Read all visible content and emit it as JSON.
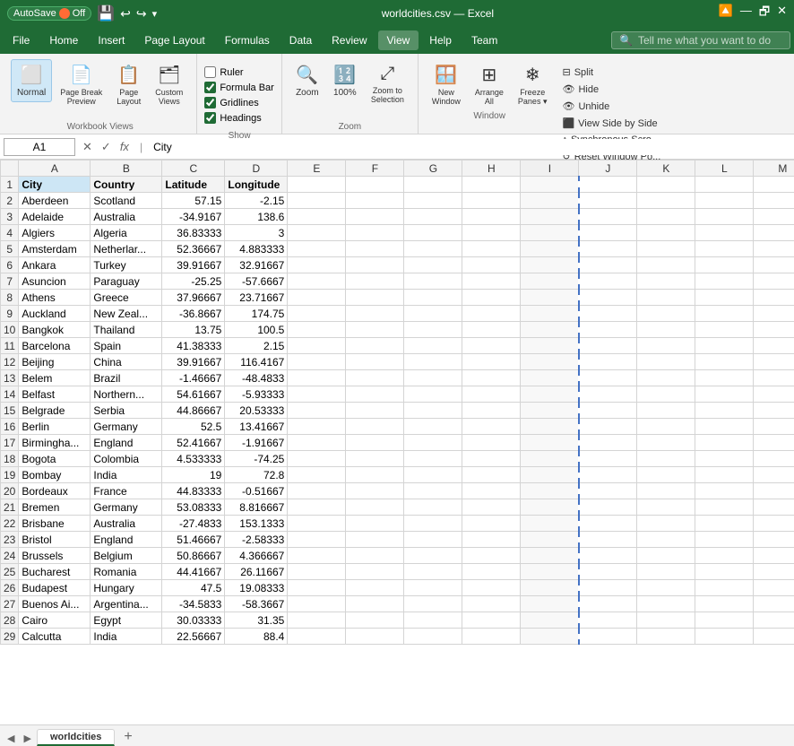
{
  "titleBar": {
    "autosave": "AutoSave",
    "autosaveState": "Off",
    "filename": "worldcities.csv",
    "appName": "Excel",
    "undoLabel": "Undo",
    "redoLabel": "Redo"
  },
  "menuBar": {
    "items": [
      "File",
      "Home",
      "Insert",
      "Page Layout",
      "Formulas",
      "Data",
      "Review",
      "View",
      "Help"
    ],
    "activeItem": "View",
    "teamLabel": "Team",
    "searchPlaceholder": "Tell me what you want to do"
  },
  "ribbon": {
    "workbookViews": {
      "label": "Workbook Views",
      "normalLabel": "Normal",
      "pageBreakLabel": "Page Break\nPreview",
      "pageLayoutLabel": "Page\nLayout",
      "customViewsLabel": "Custom\nViews"
    },
    "show": {
      "label": "Show",
      "rulerLabel": "Ruler",
      "formulaBarLabel": "Formula Bar",
      "gridlinesLabel": "Gridlines",
      "headingsLabel": "Headings",
      "rulerChecked": false,
      "formulaBarChecked": true,
      "gridlinesChecked": true,
      "headingsChecked": true
    },
    "zoom": {
      "label": "Zoom",
      "zoomLabel": "Zoom",
      "zoom100Label": "100%",
      "zoomToSelectionLabel": "Zoom to\nSelection"
    },
    "window": {
      "label": "Window",
      "newWindowLabel": "New\nWindow",
      "arrangeAllLabel": "Arrange\nAll",
      "freezePanesLabel": "Freeze\nPanes",
      "splitLabel": "Split",
      "hideLabel": "Hide",
      "unhideLabel": "Unhide",
      "viewSideLabel": "View Side by Side",
      "syncScrollLabel": "Synchronous Scro...",
      "resetLabel": "Reset Window Po..."
    }
  },
  "formulaBar": {
    "nameBox": "A1",
    "formula": "City",
    "cancelLabel": "✕",
    "confirmLabel": "✓"
  },
  "columns": [
    "",
    "A",
    "B",
    "C",
    "D",
    "E",
    "F",
    "G",
    "H",
    "I",
    "J",
    "K",
    "L",
    "M"
  ],
  "headers": [
    "City",
    "Country",
    "Latitude",
    "Longitude"
  ],
  "rows": [
    {
      "num": 1,
      "city": "City",
      "country": "Country",
      "lat": "Latitude",
      "lon": "Longitude",
      "isHeader": true
    },
    {
      "num": 2,
      "city": "Aberdeen",
      "country": "Scotland",
      "lat": "57.15",
      "lon": "-2.15"
    },
    {
      "num": 3,
      "city": "Adelaide",
      "country": "Australia",
      "lat": "-34.9167",
      "lon": "138.6"
    },
    {
      "num": 4,
      "city": "Algiers",
      "country": "Algeria",
      "lat": "36.83333",
      "lon": "3"
    },
    {
      "num": 5,
      "city": "Amsterdam",
      "country": "Netherlar...",
      "lat": "52.36667",
      "lon": "4.883333"
    },
    {
      "num": 6,
      "city": "Ankara",
      "country": "Turkey",
      "lat": "39.91667",
      "lon": "32.91667"
    },
    {
      "num": 7,
      "city": "Asuncion",
      "country": "Paraguay",
      "lat": "-25.25",
      "lon": "-57.6667"
    },
    {
      "num": 8,
      "city": "Athens",
      "country": "Greece",
      "lat": "37.96667",
      "lon": "23.71667"
    },
    {
      "num": 9,
      "city": "Auckland",
      "country": "New Zeal...",
      "lat": "-36.8667",
      "lon": "174.75"
    },
    {
      "num": 10,
      "city": "Bangkok",
      "country": "Thailand",
      "lat": "13.75",
      "lon": "100.5"
    },
    {
      "num": 11,
      "city": "Barcelona",
      "country": "Spain",
      "lat": "41.38333",
      "lon": "2.15"
    },
    {
      "num": 12,
      "city": "Beijing",
      "country": "China",
      "lat": "39.91667",
      "lon": "116.4167"
    },
    {
      "num": 13,
      "city": "Belem",
      "country": "Brazil",
      "lat": "-1.46667",
      "lon": "-48.4833"
    },
    {
      "num": 14,
      "city": "Belfast",
      "country": "Northern...",
      "lat": "54.61667",
      "lon": "-5.93333"
    },
    {
      "num": 15,
      "city": "Belgrade",
      "country": "Serbia",
      "lat": "44.86667",
      "lon": "20.53333"
    },
    {
      "num": 16,
      "city": "Berlin",
      "country": "Germany",
      "lat": "52.5",
      "lon": "13.41667"
    },
    {
      "num": 17,
      "city": "Birmingha...",
      "country": "England",
      "lat": "52.41667",
      "lon": "-1.91667"
    },
    {
      "num": 18,
      "city": "Bogota",
      "country": "Colombia",
      "lat": "4.533333",
      "lon": "-74.25"
    },
    {
      "num": 19,
      "city": "Bombay",
      "country": "India",
      "lat": "19",
      "lon": "72.8"
    },
    {
      "num": 20,
      "city": "Bordeaux",
      "country": "France",
      "lat": "44.83333",
      "lon": "-0.51667"
    },
    {
      "num": 21,
      "city": "Bremen",
      "country": "Germany",
      "lat": "53.08333",
      "lon": "8.816667"
    },
    {
      "num": 22,
      "city": "Brisbane",
      "country": "Australia",
      "lat": "-27.4833",
      "lon": "153.1333"
    },
    {
      "num": 23,
      "city": "Bristol",
      "country": "England",
      "lat": "51.46667",
      "lon": "-2.58333"
    },
    {
      "num": 24,
      "city": "Brussels",
      "country": "Belgium",
      "lat": "50.86667",
      "lon": "4.366667"
    },
    {
      "num": 25,
      "city": "Bucharest",
      "country": "Romania",
      "lat": "44.41667",
      "lon": "26.11667"
    },
    {
      "num": 26,
      "city": "Budapest",
      "country": "Hungary",
      "lat": "47.5",
      "lon": "19.08333"
    },
    {
      "num": 27,
      "city": "Buenos Ai...",
      "country": "Argentina...",
      "lat": "-34.5833",
      "lon": "-58.3667"
    },
    {
      "num": 28,
      "city": "Cairo",
      "country": "Egypt",
      "lat": "30.03333",
      "lon": "31.35"
    },
    {
      "num": 29,
      "city": "Calcutta",
      "country": "India",
      "lat": "22.56667",
      "lon": "88.4"
    }
  ],
  "sheetTabs": {
    "activeTab": "worldcities",
    "tabs": [
      "worldcities"
    ],
    "addLabel": "+"
  }
}
